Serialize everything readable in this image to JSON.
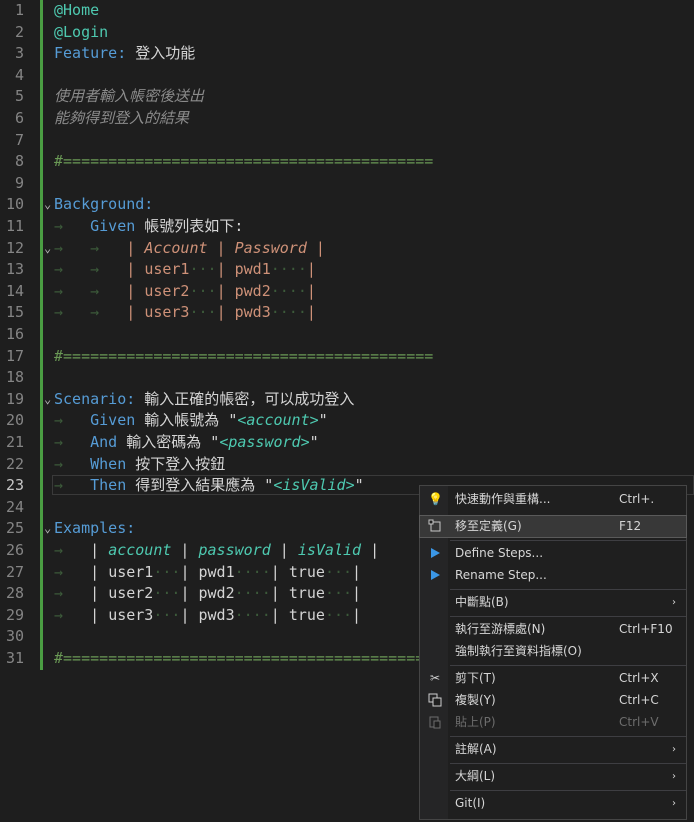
{
  "editor": {
    "lines": [
      {
        "n": "1"
      },
      {
        "n": "2"
      },
      {
        "n": "3"
      },
      {
        "n": "4"
      },
      {
        "n": "5"
      },
      {
        "n": "6"
      },
      {
        "n": "7"
      },
      {
        "n": "8"
      },
      {
        "n": "9"
      },
      {
        "n": "10"
      },
      {
        "n": "11"
      },
      {
        "n": "12"
      },
      {
        "n": "13"
      },
      {
        "n": "14"
      },
      {
        "n": "15"
      },
      {
        "n": "16"
      },
      {
        "n": "17"
      },
      {
        "n": "18"
      },
      {
        "n": "19"
      },
      {
        "n": "20"
      },
      {
        "n": "21"
      },
      {
        "n": "22"
      },
      {
        "n": "23"
      },
      {
        "n": "24"
      },
      {
        "n": "25"
      },
      {
        "n": "26"
      },
      {
        "n": "27"
      },
      {
        "n": "28"
      },
      {
        "n": "29"
      },
      {
        "n": "30"
      },
      {
        "n": "31"
      }
    ],
    "tag_home": "@Home",
    "tag_login": "@Login",
    "feature_kw": "Feature:",
    "feature_title": " 登入功能",
    "desc1": "使用者輸入帳密後送出",
    "desc2": "能夠得到登入的結果",
    "separator": "#=========================================",
    "background_kw": "Background:",
    "given_kw": "Given",
    "given_bg_text": " 帳號列表如下:",
    "bg_table": {
      "headers": [
        "Account",
        "Password"
      ],
      "rows": [
        [
          "user1",
          "pwd1"
        ],
        [
          "user2",
          "pwd2"
        ],
        [
          "user3",
          "pwd3"
        ]
      ]
    },
    "scenario_kw": "Scenario:",
    "scenario_title": " 輸入正確的帳密，可以成功登入",
    "step_given_text": " 輸入帳號為 \"",
    "step_given_ph": "<account>",
    "and_kw": "And",
    "step_and_text": " 輸入密碼為 \"",
    "step_and_ph": "<password>",
    "when_kw": "When",
    "step_when_text": " 按下登入按鈕",
    "then_kw": "Then",
    "step_then_text": " 得到登入結果應為 \"",
    "step_then_ph": "<isValid>",
    "quote": "\"",
    "examples_kw": "Examples:",
    "ex_table": {
      "headers": [
        "account",
        "password",
        "isValid"
      ],
      "rows": [
        [
          "user1",
          "pwd1",
          "true"
        ],
        [
          "user2",
          "pwd2",
          "true"
        ],
        [
          "user3",
          "pwd3",
          "true"
        ]
      ]
    },
    "active_line": "23"
  },
  "menu": {
    "quick_actions": {
      "label": "快速動作與重構...",
      "shortcut": "Ctrl+."
    },
    "goto_def": {
      "label": "移至定義(G)",
      "shortcut": "F12"
    },
    "define_steps": {
      "label": "Define Steps..."
    },
    "rename_step": {
      "label": "Rename Step..."
    },
    "breakpoint": {
      "label": "中斷點(B)"
    },
    "run_to_cursor": {
      "label": "執行至游標處(N)",
      "shortcut": "Ctrl+F10"
    },
    "force_run": {
      "label": "強制執行至資料指標(O)"
    },
    "cut": {
      "label": "剪下(T)",
      "shortcut": "Ctrl+X"
    },
    "copy": {
      "label": "複製(Y)",
      "shortcut": "Ctrl+C"
    },
    "paste": {
      "label": "貼上(P)",
      "shortcut": "Ctrl+V"
    },
    "comment": {
      "label": "註解(A)"
    },
    "outline": {
      "label": "大綱(L)"
    },
    "git": {
      "label": "Git(I)"
    },
    "arrow": "›"
  },
  "colors": {
    "accent_green": "#4a9d42",
    "keyword": "#569cd6",
    "string": "#ce9178",
    "tag": "#4ec9b0"
  }
}
